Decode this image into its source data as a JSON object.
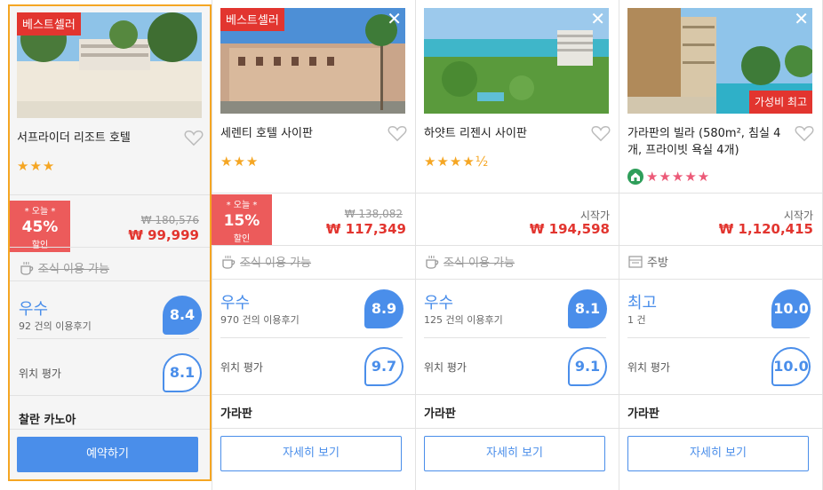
{
  "hotels": [
    {
      "badge": "베스트셀러",
      "name": "서프라이더 리조트 호텔",
      "stars": "★★★",
      "deal": {
        "line1": "* 오늘 *",
        "percent": "45%",
        "line3": "할인"
      },
      "original_price": "₩ 180,576",
      "price": "₩ 99,999",
      "amenity": "조식 이용 가능",
      "rating_word": "우수",
      "review_count": "92 건의 이용후기",
      "score": "8.4",
      "location_label": "위치 평가",
      "location_score": "8.1",
      "area": "찰란 카노아",
      "button": "예약하기"
    },
    {
      "badge": "베스트셀러",
      "close": "✕",
      "name": "세렌티 호텔 사이판",
      "stars": "★★★",
      "deal": {
        "line1": "* 오늘 *",
        "percent": "15%",
        "line3": "할인"
      },
      "original_price": "₩ 138,082",
      "price": "₩ 117,349",
      "amenity": "조식 이용 가능",
      "rating_word": "우수",
      "review_count": "970 건의 이용후기",
      "score": "8.9",
      "location_label": "위치 평가",
      "location_score": "9.7",
      "area": "가라판",
      "button": "자세히 보기"
    },
    {
      "close": "✕",
      "name": "하얏트 리젠시 사이판",
      "stars": "★★★★½",
      "start_label": "시작가",
      "price": "₩ 194,598",
      "amenity": "조식 이용 가능",
      "rating_word": "우수",
      "review_count": "125 건의 이용후기",
      "score": "8.1",
      "location_label": "위치 평가",
      "location_score": "9.1",
      "area": "가라판",
      "button": "자세히 보기"
    },
    {
      "close": "✕",
      "badge_br": "가성비 최고",
      "name": "가라판의 빌라 (580m², 침실 4개, 프라이빗 욕실 4개)",
      "stars": "★★★★★",
      "start_label": "시작가",
      "price": "₩ 1,120,415",
      "amenity": "주방",
      "rating_word": "최고",
      "review_count": "1 건",
      "score": "10.0",
      "location_label": "위치 평가",
      "location_score": "10.0",
      "area": "가라판",
      "button": "자세히 보기"
    }
  ],
  "colors": {
    "accent_blue": "#4a8eea",
    "price_red": "#e2352f",
    "deal_red": "#ec5b5b",
    "star_gold": "#f5a623",
    "star_pink": "#ec5a78",
    "selected_border": "#f5a623"
  },
  "icons": {
    "favorite": "heart-icon",
    "remove": "close-icon",
    "breakfast": "coffee-cup-icon",
    "kitchen": "kitchen-icon",
    "vacation_rental": "house-icon"
  }
}
